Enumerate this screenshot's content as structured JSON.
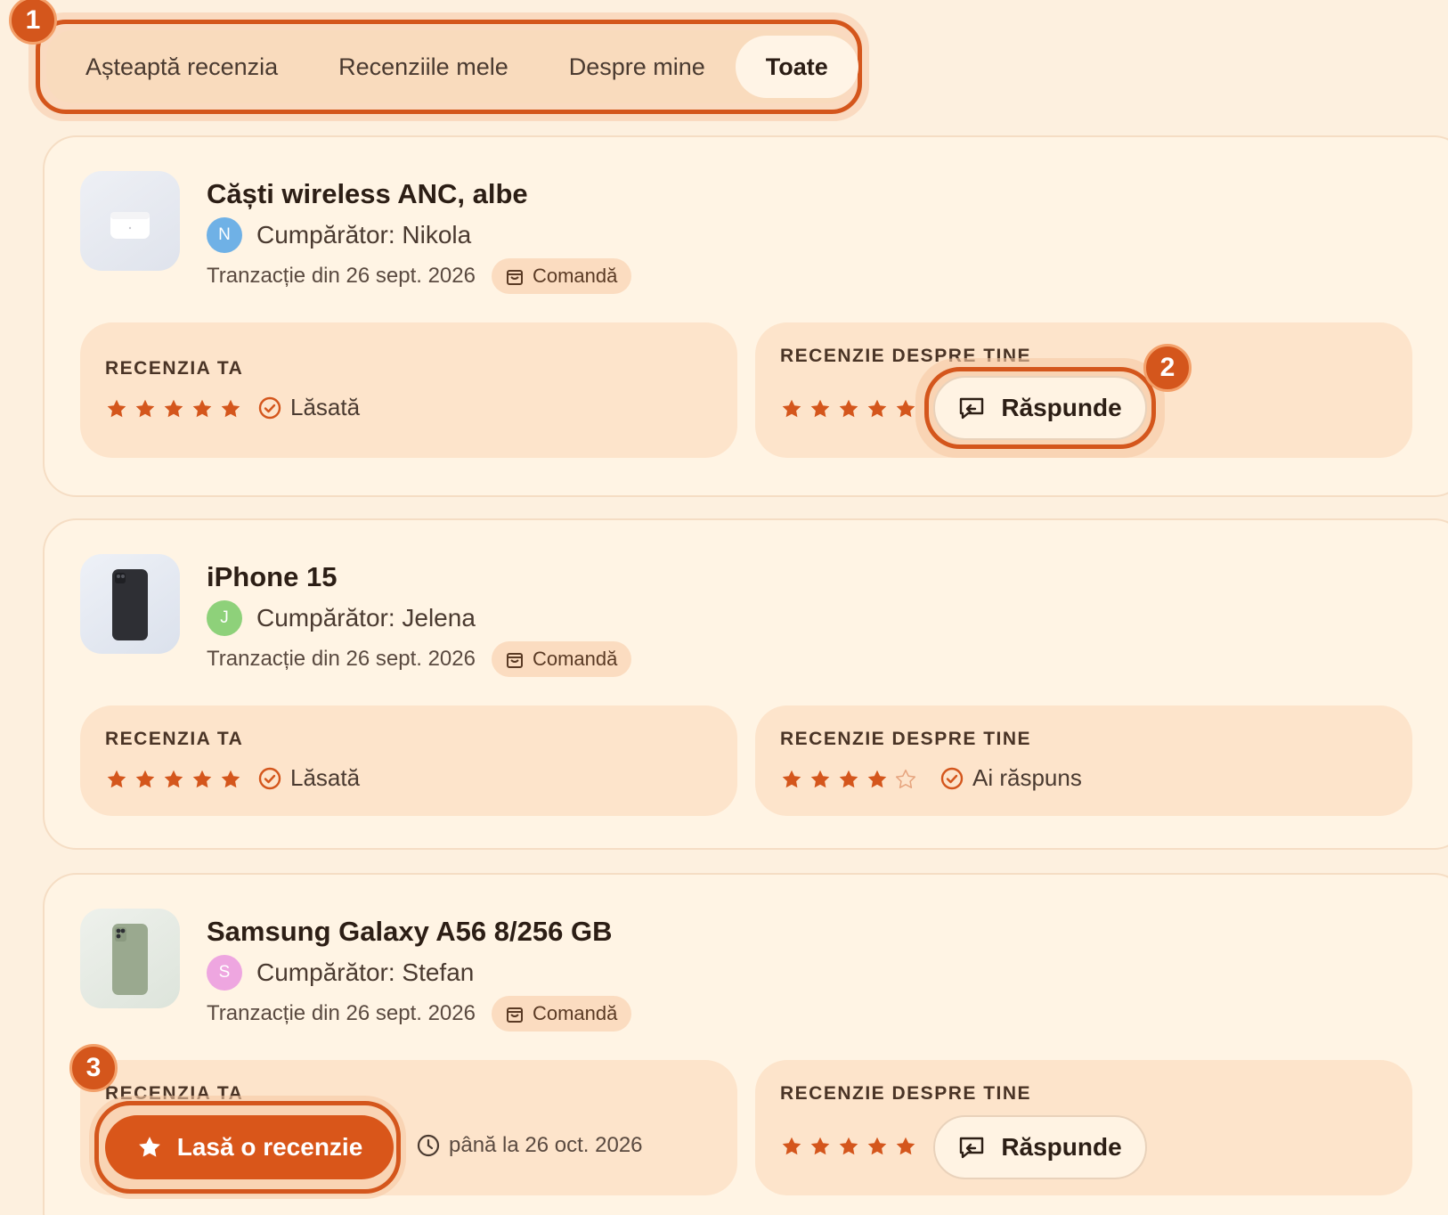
{
  "tabs": [
    {
      "label": "Așteaptă recenzia",
      "active": false
    },
    {
      "label": "Recenziile mele",
      "active": false
    },
    {
      "label": "Despre mine",
      "active": false
    },
    {
      "label": "Toate",
      "active": true
    }
  ],
  "markers": [
    "1",
    "2",
    "3"
  ],
  "labels": {
    "your_review": "RECENZIA TA",
    "review_about_you": "RECENZIE DESPRE TINE",
    "order_badge": "Comandă",
    "reply_button": "Răspunde",
    "leave_review_button": "Lasă o recenzie",
    "status_left": "Lăsată",
    "status_replied": "Ai răspuns"
  },
  "colors": {
    "accent": "#d4561c",
    "background": "#fdf0df",
    "card": "#fff4e4",
    "panel": "#fde4cb"
  },
  "cards": [
    {
      "title": "Căști wireless ANC, albe",
      "buyer": "Cumpărător: Nikola",
      "buyer_initial": "N",
      "avatar_color": "#6fb1e6",
      "transaction": "Tranzacție din 26 sept. 2026",
      "your_review": {
        "stars": 5,
        "status": "Lăsată"
      },
      "about_you": {
        "stars": 5,
        "action": "Răspunde"
      }
    },
    {
      "title": "iPhone 15",
      "buyer": "Cumpărător: Jelena",
      "buyer_initial": "J",
      "avatar_color": "#8ed17a",
      "transaction": "Tranzacție din 26 sept. 2026",
      "your_review": {
        "stars": 5,
        "status": "Lăsată"
      },
      "about_you": {
        "stars": 4,
        "status": "Ai răspuns"
      }
    },
    {
      "title": "Samsung Galaxy A56 8/256 GB",
      "buyer": "Cumpărător: Stefan",
      "buyer_initial": "S",
      "avatar_color": "#eea6e0",
      "transaction": "Tranzacție din 26 sept. 2026",
      "your_review": {
        "action": "Lasă o recenzie",
        "deadline": "până la 26 oct. 2026"
      },
      "about_you": {
        "stars": 5,
        "action": "Răspunde"
      }
    }
  ]
}
